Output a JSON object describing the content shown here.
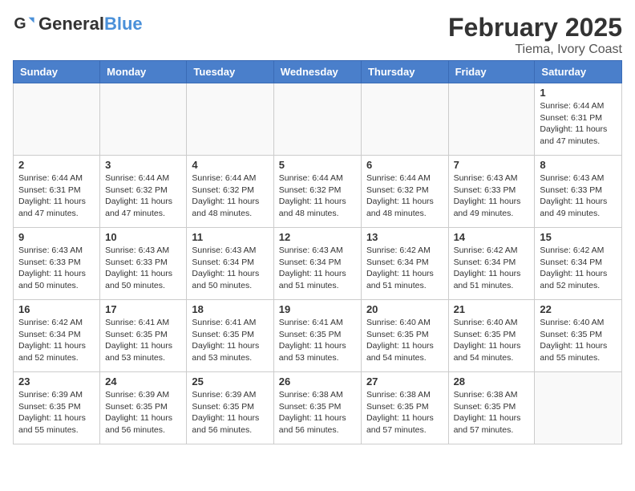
{
  "header": {
    "logo_general": "General",
    "logo_blue": "Blue",
    "month_title": "February 2025",
    "location": "Tiema, Ivory Coast"
  },
  "weekdays": [
    "Sunday",
    "Monday",
    "Tuesday",
    "Wednesday",
    "Thursday",
    "Friday",
    "Saturday"
  ],
  "weeks": [
    [
      {
        "day": "",
        "info": ""
      },
      {
        "day": "",
        "info": ""
      },
      {
        "day": "",
        "info": ""
      },
      {
        "day": "",
        "info": ""
      },
      {
        "day": "",
        "info": ""
      },
      {
        "day": "",
        "info": ""
      },
      {
        "day": "1",
        "info": "Sunrise: 6:44 AM\nSunset: 6:31 PM\nDaylight: 11 hours and 47 minutes."
      }
    ],
    [
      {
        "day": "2",
        "info": "Sunrise: 6:44 AM\nSunset: 6:31 PM\nDaylight: 11 hours and 47 minutes."
      },
      {
        "day": "3",
        "info": "Sunrise: 6:44 AM\nSunset: 6:32 PM\nDaylight: 11 hours and 47 minutes."
      },
      {
        "day": "4",
        "info": "Sunrise: 6:44 AM\nSunset: 6:32 PM\nDaylight: 11 hours and 48 minutes."
      },
      {
        "day": "5",
        "info": "Sunrise: 6:44 AM\nSunset: 6:32 PM\nDaylight: 11 hours and 48 minutes."
      },
      {
        "day": "6",
        "info": "Sunrise: 6:44 AM\nSunset: 6:32 PM\nDaylight: 11 hours and 48 minutes."
      },
      {
        "day": "7",
        "info": "Sunrise: 6:43 AM\nSunset: 6:33 PM\nDaylight: 11 hours and 49 minutes."
      },
      {
        "day": "8",
        "info": "Sunrise: 6:43 AM\nSunset: 6:33 PM\nDaylight: 11 hours and 49 minutes."
      }
    ],
    [
      {
        "day": "9",
        "info": "Sunrise: 6:43 AM\nSunset: 6:33 PM\nDaylight: 11 hours and 50 minutes."
      },
      {
        "day": "10",
        "info": "Sunrise: 6:43 AM\nSunset: 6:33 PM\nDaylight: 11 hours and 50 minutes."
      },
      {
        "day": "11",
        "info": "Sunrise: 6:43 AM\nSunset: 6:34 PM\nDaylight: 11 hours and 50 minutes."
      },
      {
        "day": "12",
        "info": "Sunrise: 6:43 AM\nSunset: 6:34 PM\nDaylight: 11 hours and 51 minutes."
      },
      {
        "day": "13",
        "info": "Sunrise: 6:42 AM\nSunset: 6:34 PM\nDaylight: 11 hours and 51 minutes."
      },
      {
        "day": "14",
        "info": "Sunrise: 6:42 AM\nSunset: 6:34 PM\nDaylight: 11 hours and 51 minutes."
      },
      {
        "day": "15",
        "info": "Sunrise: 6:42 AM\nSunset: 6:34 PM\nDaylight: 11 hours and 52 minutes."
      }
    ],
    [
      {
        "day": "16",
        "info": "Sunrise: 6:42 AM\nSunset: 6:34 PM\nDaylight: 11 hours and 52 minutes."
      },
      {
        "day": "17",
        "info": "Sunrise: 6:41 AM\nSunset: 6:35 PM\nDaylight: 11 hours and 53 minutes."
      },
      {
        "day": "18",
        "info": "Sunrise: 6:41 AM\nSunset: 6:35 PM\nDaylight: 11 hours and 53 minutes."
      },
      {
        "day": "19",
        "info": "Sunrise: 6:41 AM\nSunset: 6:35 PM\nDaylight: 11 hours and 53 minutes."
      },
      {
        "day": "20",
        "info": "Sunrise: 6:40 AM\nSunset: 6:35 PM\nDaylight: 11 hours and 54 minutes."
      },
      {
        "day": "21",
        "info": "Sunrise: 6:40 AM\nSunset: 6:35 PM\nDaylight: 11 hours and 54 minutes."
      },
      {
        "day": "22",
        "info": "Sunrise: 6:40 AM\nSunset: 6:35 PM\nDaylight: 11 hours and 55 minutes."
      }
    ],
    [
      {
        "day": "23",
        "info": "Sunrise: 6:39 AM\nSunset: 6:35 PM\nDaylight: 11 hours and 55 minutes."
      },
      {
        "day": "24",
        "info": "Sunrise: 6:39 AM\nSunset: 6:35 PM\nDaylight: 11 hours and 56 minutes."
      },
      {
        "day": "25",
        "info": "Sunrise: 6:39 AM\nSunset: 6:35 PM\nDaylight: 11 hours and 56 minutes."
      },
      {
        "day": "26",
        "info": "Sunrise: 6:38 AM\nSunset: 6:35 PM\nDaylight: 11 hours and 56 minutes."
      },
      {
        "day": "27",
        "info": "Sunrise: 6:38 AM\nSunset: 6:35 PM\nDaylight: 11 hours and 57 minutes."
      },
      {
        "day": "28",
        "info": "Sunrise: 6:38 AM\nSunset: 6:35 PM\nDaylight: 11 hours and 57 minutes."
      },
      {
        "day": "",
        "info": ""
      }
    ]
  ]
}
